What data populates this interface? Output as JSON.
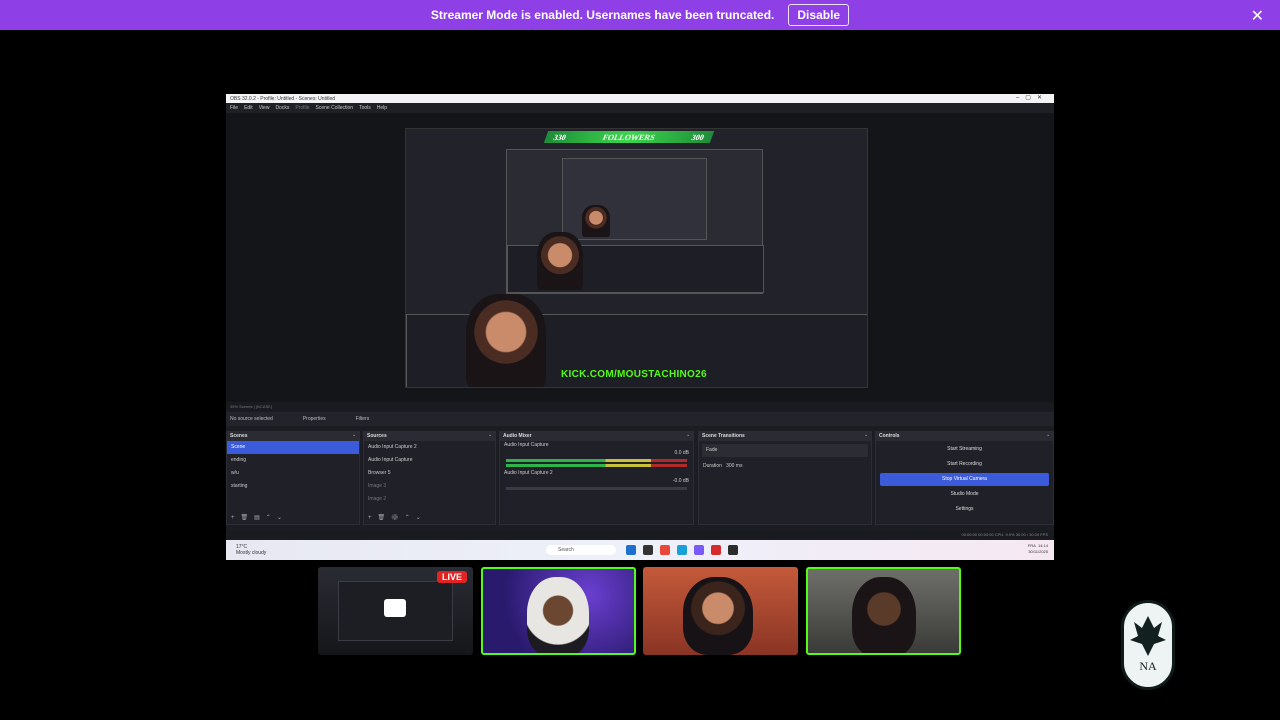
{
  "banner": {
    "message": "Streamer Mode is enabled. Usernames have been truncated.",
    "button": "Disable",
    "close": "✕",
    "color": "#8f3fe6"
  },
  "obs": {
    "window_title": "OBS 32.0.2 - Profile: Untitled - Scenes: Untitled",
    "menu": [
      "File",
      "Edit",
      "View",
      "Docks",
      "Profile",
      "Scene Collection",
      "Tools",
      "Help"
    ],
    "overlay": {
      "followers_label": "FOLLOWERS",
      "left_count": "330",
      "right_count": "300",
      "kick_url": "KICK.COM/MOUSTACHINO26"
    },
    "status_strip": "35%   Scenes | (NCASE)",
    "no_source": "No source selected",
    "properties": "Properties",
    "filters": "Filters",
    "scenes": {
      "title": "Scenes",
      "items": [
        "Scene",
        "ending",
        "w/u",
        "starting"
      ]
    },
    "sources": {
      "title": "Sources",
      "items": [
        "Audio Input Capture 2",
        "Audio Input Capture",
        "Browser 5",
        "Image 3",
        "Image 2"
      ]
    },
    "mixer": {
      "title": "Audio Mixer",
      "channels": [
        {
          "name": "Audio Input Capture",
          "db": "0.0 dB"
        },
        {
          "name": "Audio Input Capture 2",
          "db": "-0.0 dB"
        }
      ]
    },
    "transitions": {
      "title": "Scene Transitions",
      "type": "Fade",
      "duration_label": "Duration",
      "duration": "300 ms"
    },
    "controls": {
      "title": "Controls",
      "buttons": [
        "Start Streaming",
        "Start Recording",
        "Stop Virtual Camera",
        "Studio Mode",
        "Settings"
      ]
    },
    "win_status": "00:00:00    00:00:00    CPU: 9.9%    30.00 / 30.00 FPS"
  },
  "taskbar": {
    "weather_temp": "17°C",
    "weather_desc": "Mostly cloudy",
    "search": "Search",
    "lang": "FRA",
    "time": "14:14",
    "date": "30/11/2025"
  },
  "participants": {
    "live_badge": "LIVE",
    "accent": "#53fc18"
  }
}
